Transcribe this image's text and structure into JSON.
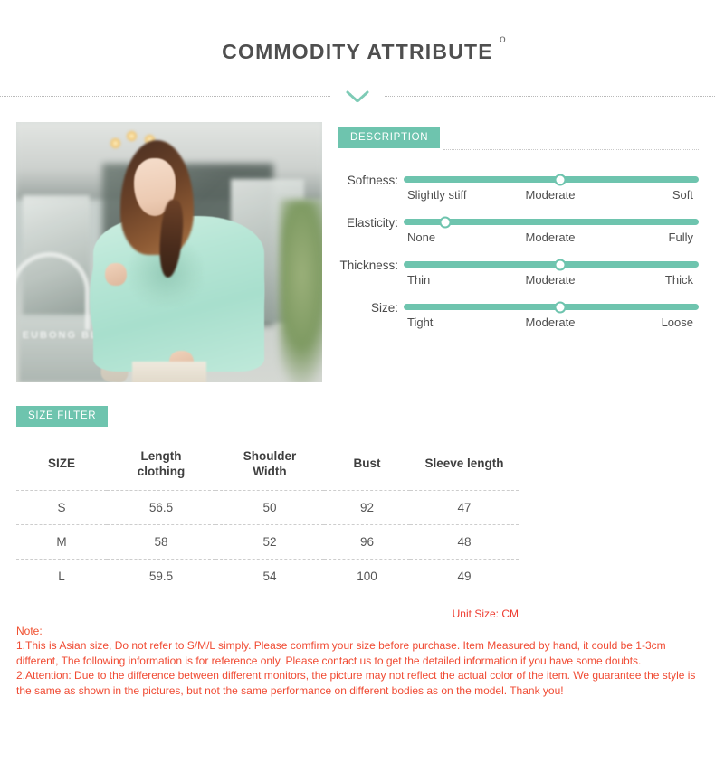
{
  "header": {
    "title": "COMMODITY ATTRIBUTE",
    "title_superscript": "o",
    "chevron_icon": "chevron-down-icon"
  },
  "product_image": {
    "alt": "Model wearing mint green knit sweater outdoors",
    "sign_text": "EUBONG BLOCK"
  },
  "description": {
    "badge_label": "DESCRIPTION",
    "attributes": [
      {
        "label": "Softness:",
        "value_percent": 53,
        "scale": [
          "Slightly stiff",
          "Moderate",
          "Soft"
        ]
      },
      {
        "label": "Elasticity:",
        "value_percent": 14,
        "scale": [
          "None",
          "Moderate",
          "Fully"
        ]
      },
      {
        "label": "Thickness:",
        "value_percent": 53,
        "scale": [
          "Thin",
          "Moderate",
          "Thick"
        ]
      },
      {
        "label": "Size:",
        "value_percent": 53,
        "scale": [
          "Tight",
          "Moderate",
          "Loose"
        ]
      }
    ]
  },
  "size_filter": {
    "badge_label": "SIZE FILTER",
    "columns": [
      "SIZE",
      "Length clothing",
      "Shoulder Width",
      "Bust",
      "Sleeve length"
    ],
    "columns_lines": [
      [
        "SIZE"
      ],
      [
        "Length",
        "clothing"
      ],
      [
        "Shoulder",
        "Width"
      ],
      [
        "Bust"
      ],
      [
        "Sleeve length"
      ]
    ],
    "rows": [
      {
        "size": "S",
        "length_clothing": "56.5",
        "shoulder_width": "50",
        "bust": "92",
        "sleeve_length": "47"
      },
      {
        "size": "M",
        "length_clothing": "58",
        "shoulder_width": "52",
        "bust": "96",
        "sleeve_length": "48"
      },
      {
        "size": "L",
        "length_clothing": "59.5",
        "shoulder_width": "54",
        "bust": "100",
        "sleeve_length": "49"
      }
    ],
    "unit_note": "Unit Size: CM"
  },
  "note": {
    "heading": "Note:",
    "line1": "1.This is Asian size, Do not refer to S/M/L simply. Please comfirm your size before purchase. Item Measured by hand, it could be 1-3cm different, The following information is for reference only. Please contact us to get the detailed information if you have some doubts.",
    "line2": "2.Attention: Due to the difference between different monitors, the picture may not reflect the actual color of the item. We guarantee the style is the same as shown in the pictures, but not the same performance on different bodies as on the model. Thank you!"
  },
  "colors": {
    "accent_teal": "#6ec4ae",
    "note_red": "#f04a32",
    "title_gray": "#4f4f4f"
  }
}
